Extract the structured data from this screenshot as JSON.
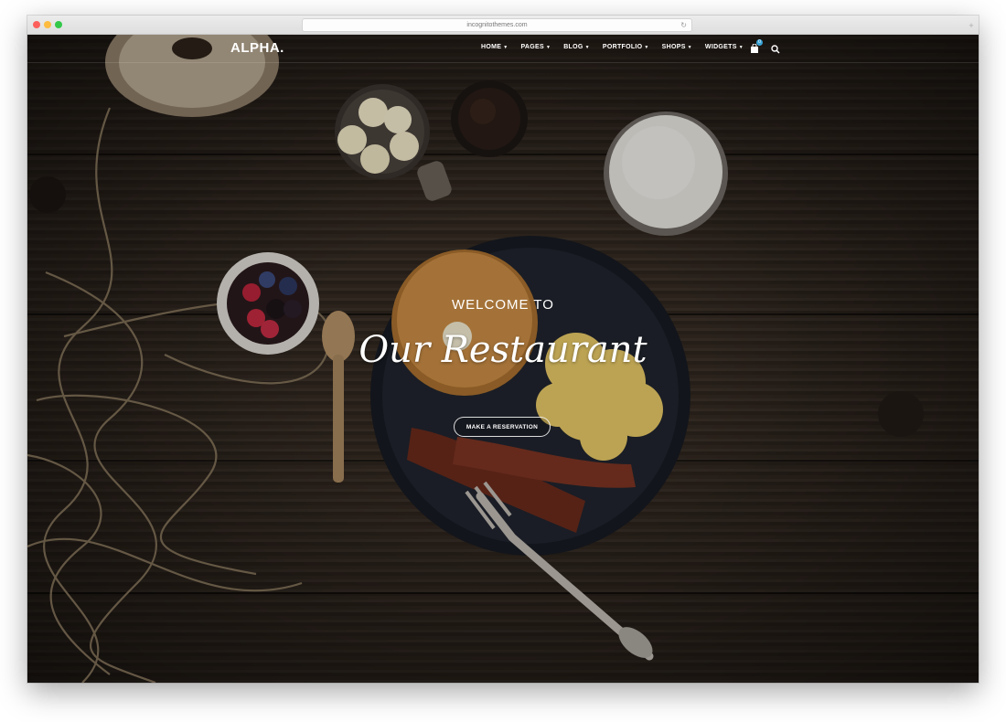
{
  "browser": {
    "url": "incognitothemes.com"
  },
  "site": {
    "logo": "ALPHA."
  },
  "nav": {
    "items": [
      {
        "label": "HOME"
      },
      {
        "label": "PAGES"
      },
      {
        "label": "BLOG"
      },
      {
        "label": "PORTFOLIO"
      },
      {
        "label": "SHOPS"
      },
      {
        "label": "WIDGETS"
      }
    ],
    "cart_count": "0"
  },
  "hero": {
    "kicker": "WELCOME TO",
    "title": "Our Restaurant",
    "cta_label": "MAKE A RESERVATION"
  },
  "colors": {
    "accent_badge": "#39a3d6",
    "wood_dark": "#2e251e"
  }
}
